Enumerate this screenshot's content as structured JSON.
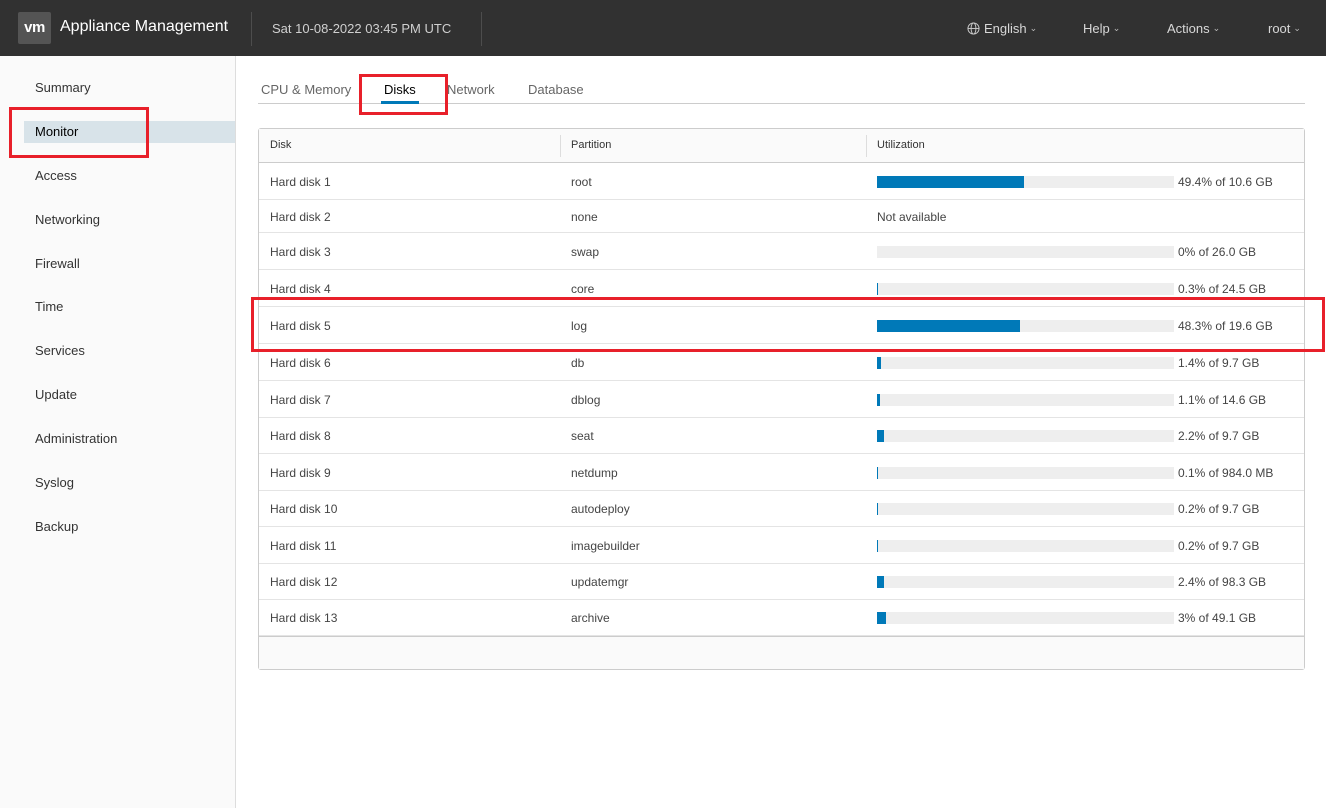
{
  "header": {
    "logo": "vm",
    "title": "Appliance Management",
    "datetime": "Sat 10-08-2022 03:45 PM UTC",
    "language": "English",
    "help": "Help",
    "actions": "Actions",
    "user": "root"
  },
  "sidebar": {
    "items": [
      {
        "label": "Summary"
      },
      {
        "label": "Monitor"
      },
      {
        "label": "Access"
      },
      {
        "label": "Networking"
      },
      {
        "label": "Firewall"
      },
      {
        "label": "Time"
      },
      {
        "label": "Services"
      },
      {
        "label": "Update"
      },
      {
        "label": "Administration"
      },
      {
        "label": "Syslog"
      },
      {
        "label": "Backup"
      }
    ],
    "active": "Monitor"
  },
  "tabs": [
    {
      "label": "CPU & Memory"
    },
    {
      "label": "Disks"
    },
    {
      "label": "Network"
    },
    {
      "label": "Database"
    }
  ],
  "active_tab": "Disks",
  "grid": {
    "headers": {
      "disk": "Disk",
      "partition": "Partition",
      "utilization": "Utilization"
    },
    "rows": [
      {
        "disk": "Hard disk 1",
        "partition": "root",
        "percent": 49.4,
        "utilization": "49.4% of 10.6 GB"
      },
      {
        "disk": "Hard disk 2",
        "partition": "none",
        "percent": null,
        "utilization": "Not available"
      },
      {
        "disk": "Hard disk 3",
        "partition": "swap",
        "percent": 0,
        "utilization": "0% of 26.0 GB"
      },
      {
        "disk": "Hard disk 4",
        "partition": "core",
        "percent": 0.3,
        "utilization": "0.3% of 24.5 GB"
      },
      {
        "disk": "Hard disk 5",
        "partition": "log",
        "percent": 48.3,
        "utilization": "48.3% of 19.6 GB"
      },
      {
        "disk": "Hard disk 6",
        "partition": "db",
        "percent": 1.4,
        "utilization": "1.4% of 9.7 GB"
      },
      {
        "disk": "Hard disk 7",
        "partition": "dblog",
        "percent": 1.1,
        "utilization": "1.1% of 14.6 GB"
      },
      {
        "disk": "Hard disk 8",
        "partition": "seat",
        "percent": 2.2,
        "utilization": "2.2% of 9.7 GB"
      },
      {
        "disk": "Hard disk 9",
        "partition": "netdump",
        "percent": 0.1,
        "utilization": "0.1% of 984.0 MB"
      },
      {
        "disk": "Hard disk 10",
        "partition": "autodeploy",
        "percent": 0.2,
        "utilization": "0.2% of 9.7 GB"
      },
      {
        "disk": "Hard disk 11",
        "partition": "imagebuilder",
        "percent": 0.2,
        "utilization": "0.2% of 9.7 GB"
      },
      {
        "disk": "Hard disk 12",
        "partition": "updatemgr",
        "percent": 2.4,
        "utilization": "2.4% of 98.3 GB"
      },
      {
        "disk": "Hard disk 13",
        "partition": "archive",
        "percent": 3,
        "utilization": "3% of 49.1 GB"
      }
    ]
  },
  "colors": {
    "accent": "#0079b8",
    "header_bg": "#313131",
    "annotation": "#e8202a"
  }
}
